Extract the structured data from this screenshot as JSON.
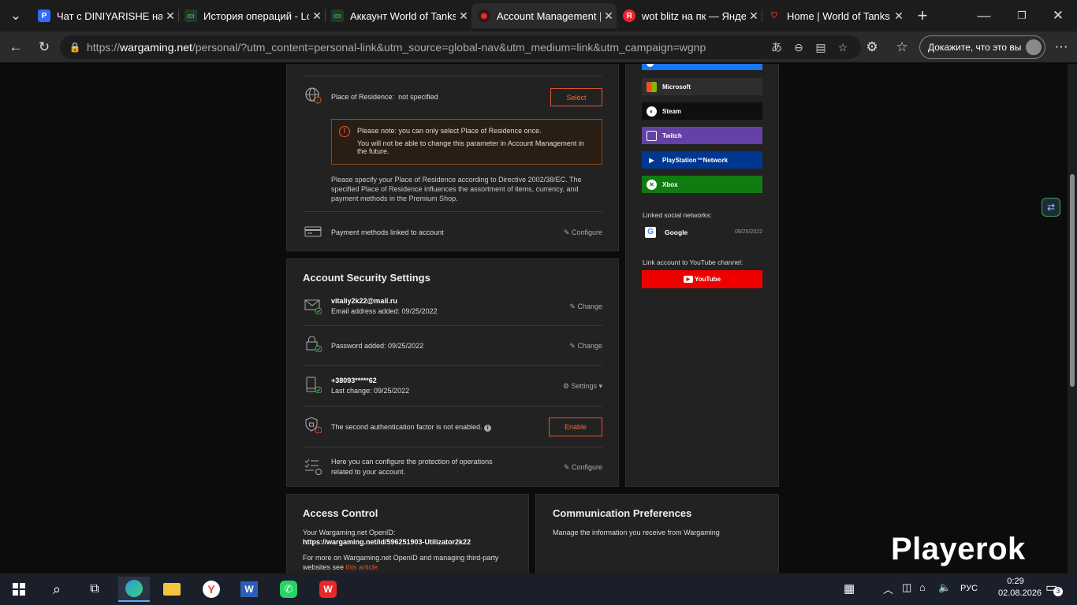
{
  "tabs": [
    {
      "title": "Чат с DINIYARISHE на Playerok",
      "favicon": "P"
    },
    {
      "title": "История операций - Lolz",
      "favicon": "lolz"
    },
    {
      "title": "Аккаунт World of Tanks Blitz",
      "favicon": "lolz"
    },
    {
      "title": "Account Management | Wargaming",
      "favicon": "wg"
    },
    {
      "title": "wot blitz на пк — Яндекс",
      "favicon": "Я"
    },
    {
      "title": "Home | World of Tanks Blitz",
      "favicon": "wotb"
    }
  ],
  "address": {
    "scheme": "https://",
    "host": "wargaming.net",
    "path": "/personal/?utm_content=personal-link&utm_source=global-nav&utm_medium=link&utm_campaign=wgnp"
  },
  "profile_button": "Докажите, что это вы",
  "residence": {
    "label": "Place of Residence:",
    "value": "not specified",
    "select_button": "Select",
    "note_line1": "Please note: you can only select Place of Residence once.",
    "note_line2": "You will not be able to change this parameter in Account Management in the future.",
    "info": "Please specify your Place of Residence according to Directive 2002/38/EC. The specified Place of Residence influences the assortment of items, currency, and payment methods in the Premium Shop."
  },
  "payment": {
    "label": "Payment methods linked to account",
    "action": "Configure"
  },
  "security": {
    "title": "Account Security Settings",
    "email": "vitaliy2k22@mail.ru",
    "email_added": "Email address added: 09/25/2022",
    "email_action": "Change",
    "password_added": "Password added: 09/25/2022",
    "password_action": "Change",
    "phone": "+38093*****62",
    "phone_change": "Last change: 09/25/2022",
    "phone_action": "Settings",
    "twofa": "The second authentication factor is not enabled.",
    "twofa_button": "Enable",
    "ops_line1": "Here you can configure the protection of operations",
    "ops_line2": "related to your account.",
    "ops_action": "Configure"
  },
  "social": {
    "buttons": [
      {
        "label": "Microsoft",
        "color": "#2e2e2e"
      },
      {
        "label": "Steam",
        "color": "#0f0f0f"
      },
      {
        "label": "Twitch",
        "color": "#6441a5"
      },
      {
        "label": "PlayStation™Network",
        "color": "#003791"
      },
      {
        "label": "Xbox",
        "color": "#107c10"
      }
    ],
    "linked_title": "Linked social networks:",
    "google_label": "Google",
    "google_date": "09/25/2022",
    "youtube_title": "Link account to YouTube channel:",
    "youtube_label": "YouTube"
  },
  "access": {
    "title": "Access Control",
    "openid_label": "Your Wargaming.net OpenID:",
    "openid_url": "https://wargaming.net/id/596251903-Utilizator2k22",
    "more_line1": "For more on Wargaming.net OpenID and managing third-party",
    "more_line2": "websites see",
    "more_link": "this article."
  },
  "comm": {
    "title": "Communication Preferences",
    "desc": "Manage the information you receive from Wargaming"
  },
  "watermark": "Playerok",
  "taskbar": {
    "lang": "РУС",
    "time": "0:29",
    "date": "02.08.2026",
    "notif": "3"
  }
}
